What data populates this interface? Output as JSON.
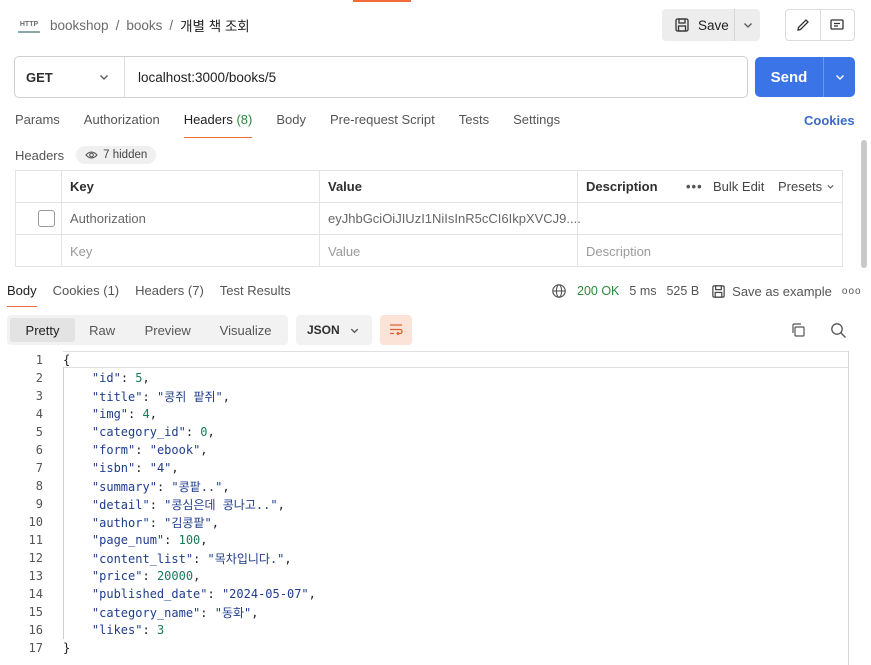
{
  "breadcrumb": {
    "badge": "HTTP",
    "items": [
      "bookshop",
      "books"
    ],
    "current": "개별 책 조회"
  },
  "toolbar": {
    "save_label": "Save"
  },
  "request": {
    "method": "GET",
    "url": "localhost:3000/books/5",
    "send_label": "Send"
  },
  "request_tabs": {
    "items": [
      "Params",
      "Authorization",
      "Headers",
      "Body",
      "Pre-request Script",
      "Tests",
      "Settings"
    ],
    "headers_count": "(8)",
    "cookies_label": "Cookies"
  },
  "headers_section": {
    "title": "Headers",
    "hidden_label": "7 hidden",
    "columns": {
      "key": "Key",
      "value": "Value",
      "description": "Description"
    },
    "bulk_edit": "Bulk Edit",
    "presets": "Presets",
    "rows": [
      {
        "key": "Authorization",
        "value": "eyJhbGciOiJIUzI1NiIsInR5cCI6IkpXVCJ9...."
      }
    ],
    "placeholder": {
      "key": "Key",
      "value": "Value",
      "description": "Description"
    }
  },
  "response_tabs": {
    "body": "Body",
    "cookies": "Cookies",
    "cookies_count": "(1)",
    "headers": "Headers",
    "headers_count": "(7)",
    "test_results": "Test Results"
  },
  "response_meta": {
    "status": "200 OK",
    "time": "5 ms",
    "size": "525 B",
    "save_example": "Save as example",
    "more": "ooo"
  },
  "view": {
    "tabs": [
      "Pretty",
      "Raw",
      "Preview",
      "Visualize"
    ],
    "active": "Pretty",
    "format": "JSON"
  },
  "code": {
    "open": "{",
    "close": "}",
    "fields": [
      {
        "key": "\"id\"",
        "value": "5",
        "type": "n"
      },
      {
        "key": "\"title\"",
        "value": "\"콩쥐 팥쥐\"",
        "type": "s"
      },
      {
        "key": "\"img\"",
        "value": "4",
        "type": "n"
      },
      {
        "key": "\"category_id\"",
        "value": "0",
        "type": "n"
      },
      {
        "key": "\"form\"",
        "value": "\"ebook\"",
        "type": "s"
      },
      {
        "key": "\"isbn\"",
        "value": "\"4\"",
        "type": "s"
      },
      {
        "key": "\"summary\"",
        "value": "\"콩팥..\"",
        "type": "s"
      },
      {
        "key": "\"detail\"",
        "value": "\"콩심은데 콩나고..\"",
        "type": "s"
      },
      {
        "key": "\"author\"",
        "value": "\"김콩팥\"",
        "type": "s"
      },
      {
        "key": "\"page_num\"",
        "value": "100",
        "type": "n"
      },
      {
        "key": "\"content_list\"",
        "value": "\"목차입니다.\"",
        "type": "s"
      },
      {
        "key": "\"price\"",
        "value": "20000",
        "type": "n"
      },
      {
        "key": "\"published_date\"",
        "value": "\"2024-05-07\"",
        "type": "s"
      },
      {
        "key": "\"category_name\"",
        "value": "\"동화\"",
        "type": "s"
      },
      {
        "key": "\"likes\"",
        "value": "3",
        "type": "n"
      }
    ]
  }
}
